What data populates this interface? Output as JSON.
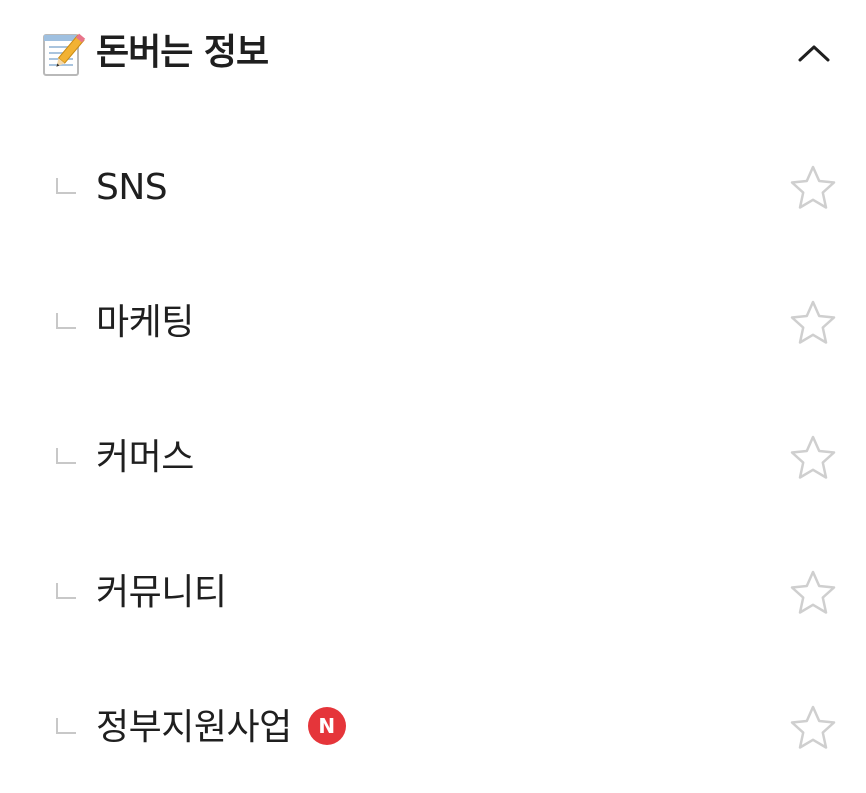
{
  "section": {
    "title": "돈버는 정보",
    "icon": "memo-icon",
    "toggle_icon": "chevron-up-icon"
  },
  "items": [
    {
      "label": "SNS",
      "branch_icon": "branch-icon",
      "favorite_icon": "star-outline-icon"
    },
    {
      "label": "마케팅",
      "branch_icon": "branch-icon",
      "favorite_icon": "star-outline-icon"
    },
    {
      "label": "커머스",
      "branch_icon": "branch-icon",
      "favorite_icon": "star-outline-icon"
    },
    {
      "label": "커뮤니티",
      "branch_icon": "branch-icon",
      "favorite_icon": "star-outline-icon"
    },
    {
      "label": "정부지원사업",
      "badge": "N",
      "branch_icon": "branch-icon",
      "favorite_icon": "star-outline-icon"
    }
  ],
  "colors": {
    "text": "#1f1f1f",
    "branch": "#c8c8c8",
    "star_outline": "#cfcfcf",
    "badge": "#e5353a"
  }
}
